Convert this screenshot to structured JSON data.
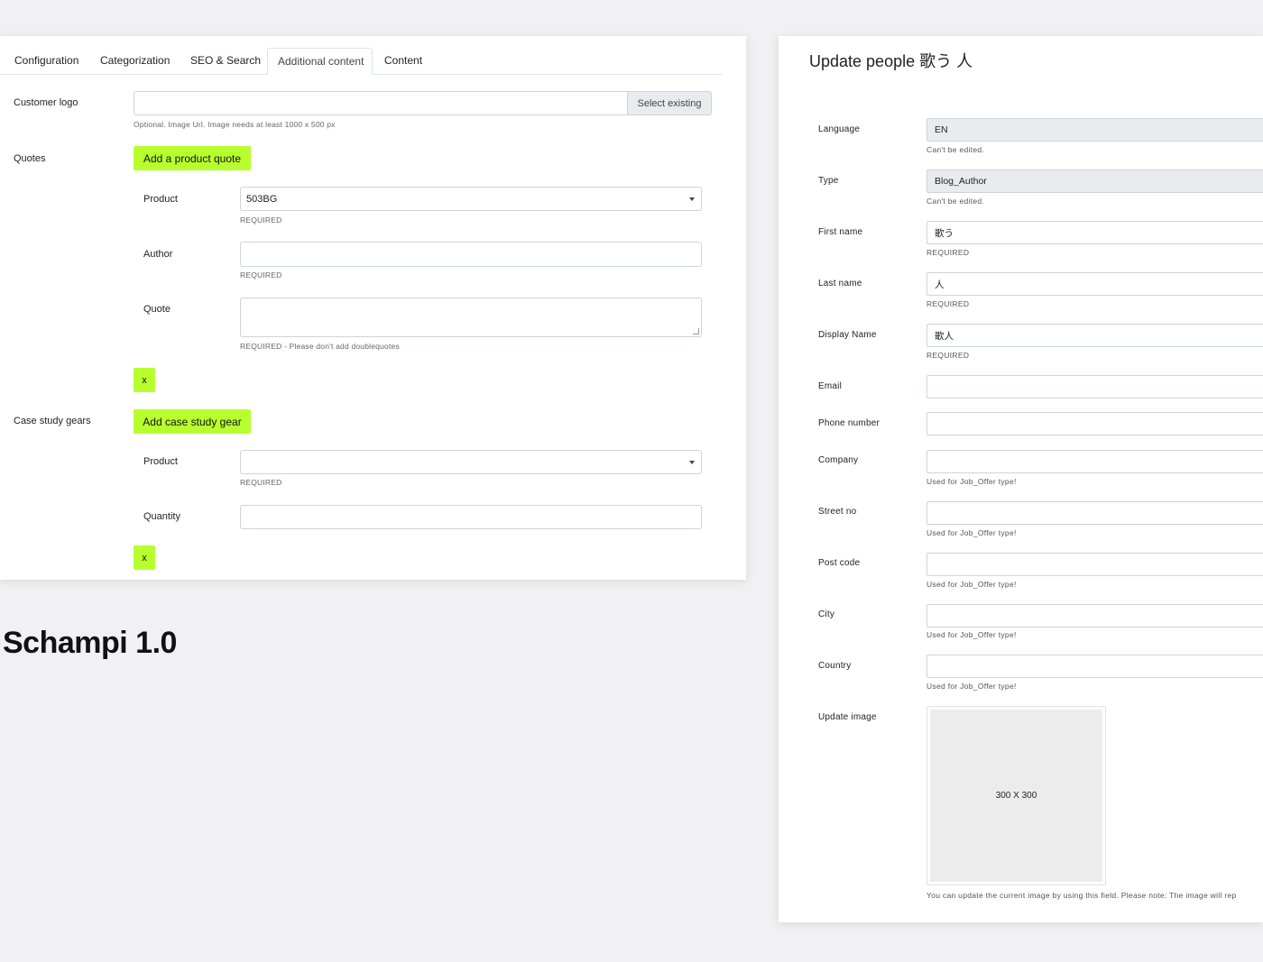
{
  "left_form": {
    "tabs": [
      "Configuration",
      "Categorization",
      "SEO & Search",
      "Additional content",
      "Content"
    ],
    "customer_logo": {
      "label": "Customer logo",
      "value": "",
      "select_button": "Select existing",
      "help": "Optional. Image Url. Image needs at least 1000 x 500 px"
    },
    "quotes": {
      "label": "Quotes",
      "add_button": "Add a product quote",
      "product_label": "Product",
      "product_value": "503BG",
      "product_help": "REQUIRED",
      "author_label": "Author",
      "author_value": "",
      "author_help": "REQUIRED",
      "quote_label": "Quote",
      "quote_value": "",
      "quote_help": "REQUIRED - Please don't add doublequotes",
      "remove_button": "x"
    },
    "gears": {
      "label": "Case study gears",
      "add_button": "Add case study gear",
      "product_label": "Product",
      "product_value": "",
      "product_help": "REQUIRED",
      "quantity_label": "Quantity",
      "quantity_value": "",
      "remove_button": "x"
    }
  },
  "caption": "Schampi 1.0",
  "right_form": {
    "title": "Update people 歌う 人",
    "fields": [
      {
        "label": "Language",
        "value": "EN",
        "readonly": true,
        "help": "Can't be edited."
      },
      {
        "label": "Type",
        "value": "Blog_Author",
        "readonly": true,
        "help": "Can't be edited."
      },
      {
        "label": "First name",
        "value": "歌う",
        "readonly": false,
        "help": "REQUIRED"
      },
      {
        "label": "Last name",
        "value": "人",
        "readonly": false,
        "help": "REQUIRED"
      },
      {
        "label": "Display Name",
        "value": "歌人",
        "readonly": false,
        "help": "REQUIRED"
      },
      {
        "label": "Email",
        "value": "",
        "readonly": false,
        "help": ""
      },
      {
        "label": "Phone number",
        "value": "",
        "readonly": false,
        "help": ""
      },
      {
        "label": "Company",
        "value": "",
        "readonly": false,
        "help": "Used for Job_Offer type!"
      },
      {
        "label": "Street no",
        "value": "",
        "readonly": false,
        "help": "Used for Job_Offer type!"
      },
      {
        "label": "Post code",
        "value": "",
        "readonly": false,
        "help": "Used for Job_Offer type!"
      },
      {
        "label": "City",
        "value": "",
        "readonly": false,
        "help": "Used for Job_Offer type!"
      },
      {
        "label": "Country",
        "value": "",
        "readonly": false,
        "help": "Used for Job_Offer type!"
      }
    ],
    "image": {
      "label": "Update image",
      "placeholder_text": "300 X 300",
      "help": "You can update the current image by using this field. Please note: The image will rep"
    }
  }
}
